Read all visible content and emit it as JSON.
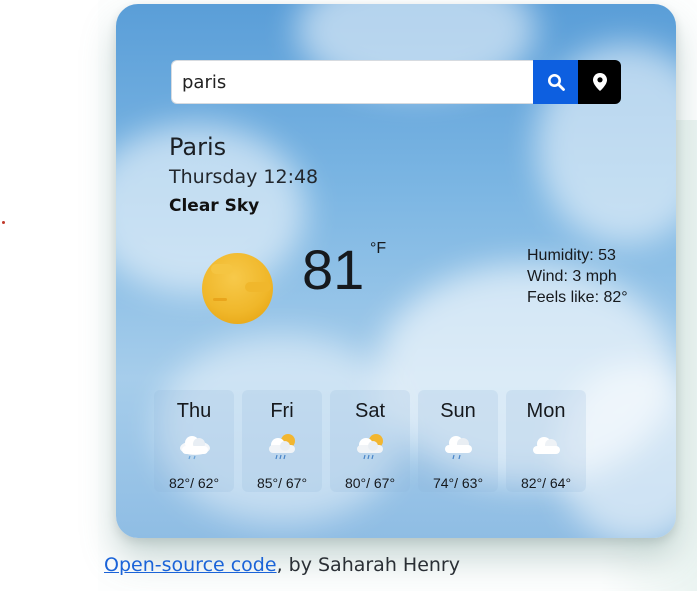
{
  "search": {
    "value": "paris"
  },
  "weather": {
    "city": "Paris",
    "datetime": "Thursday 12:48",
    "description": "Clear Sky",
    "temperature": "81",
    "unit": "°F",
    "humidity": "Humidity: 53",
    "wind": "Wind: 3 mph",
    "feels_like": "Feels like: 82°"
  },
  "forecast": [
    {
      "day": "Thu",
      "temps": "82°/ 62°",
      "icon": "cloudy-rain-icon"
    },
    {
      "day": "Fri",
      "temps": "85°/ 67°",
      "icon": "sun-cloud-rain-icon"
    },
    {
      "day": "Sat",
      "temps": "80°/ 67°",
      "icon": "sun-cloud-rain-icon"
    },
    {
      "day": "Sun",
      "temps": "74°/ 63°",
      "icon": "cloud-rain-icon"
    },
    {
      "day": "Mon",
      "temps": "82°/ 64°",
      "icon": "cloud-icon"
    }
  ],
  "footer": {
    "link": "Open-source code",
    "suffix": ", by Saharah Henry"
  },
  "colors": {
    "search_button": "#0d5fe0",
    "location_button": "#000000",
    "link": "#1a63d8"
  }
}
